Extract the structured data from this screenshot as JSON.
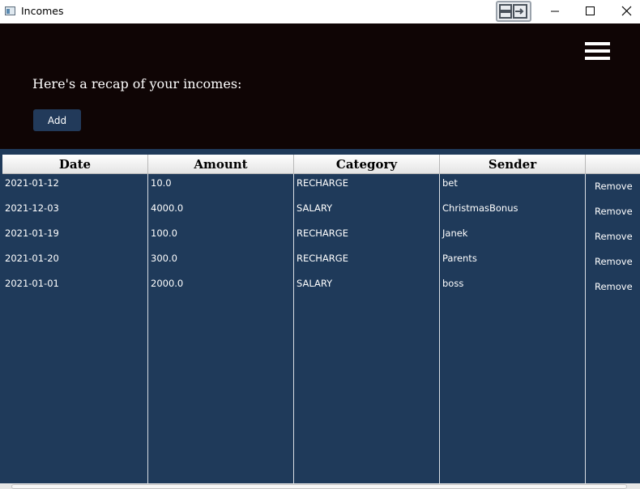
{
  "window": {
    "title": "Incomes"
  },
  "header": {
    "recap_text": "Here's a recap of your incomes:",
    "add_label": "Add"
  },
  "table": {
    "columns": [
      "Date",
      "Amount",
      "Category",
      "Sender",
      ""
    ],
    "rows": [
      {
        "date": "2021-01-12",
        "amount": "10.0",
        "category": "RECHARGE",
        "sender": "bet",
        "action": "Remove"
      },
      {
        "date": "2021-12-03",
        "amount": "4000.0",
        "category": "SALARY",
        "sender": "ChristmasBonus",
        "action": "Remove"
      },
      {
        "date": "2021-01-19",
        "amount": "100.0",
        "category": "RECHARGE",
        "sender": "Janek",
        "action": "Remove"
      },
      {
        "date": "2021-01-20",
        "amount": "300.0",
        "category": "RECHARGE",
        "sender": "Parents",
        "action": "Remove"
      },
      {
        "date": "2021-01-01",
        "amount": "2000.0",
        "category": "SALARY",
        "sender": "boss",
        "action": "Remove"
      }
    ]
  },
  "colors": {
    "header_bg": "#0f0505",
    "table_bg": "#1f3a5a",
    "button_bg": "#223a5a"
  }
}
